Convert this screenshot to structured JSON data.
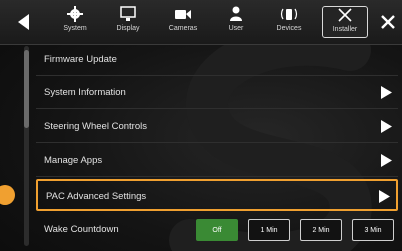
{
  "topbar": {
    "tabs": [
      {
        "label": "System",
        "icon": "gear-icon"
      },
      {
        "label": "Display",
        "icon": "monitor-icon"
      },
      {
        "label": "Cameras",
        "icon": "camera-icon"
      },
      {
        "label": "User",
        "icon": "user-icon"
      },
      {
        "label": "Devices",
        "icon": "devices-icon"
      },
      {
        "label": "Installer",
        "icon": "tools-icon",
        "active": true
      }
    ]
  },
  "menu": {
    "items": [
      {
        "label": "Firmware Update",
        "has_arrow": false
      },
      {
        "label": "System Information",
        "has_arrow": true
      },
      {
        "label": "Steering Wheel Controls",
        "has_arrow": true
      },
      {
        "label": "Manage Apps",
        "has_arrow": true
      },
      {
        "label": "PAC Advanced Settings",
        "has_arrow": true,
        "highlighted": true
      },
      {
        "label": "Wake Countdown",
        "has_arrow": false
      }
    ]
  },
  "wake_countdown": {
    "options": [
      "Off",
      "1 Min",
      "2 Min",
      "3 Min"
    ],
    "selected": "Off"
  },
  "colors": {
    "highlight": "#f0a030",
    "selected_option": "#3a8a34"
  }
}
